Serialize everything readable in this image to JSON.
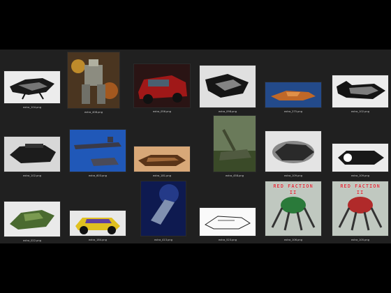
{
  "gallery": {
    "items": [
      {
        "filename": "extra_104.png",
        "style": "sketch"
      },
      {
        "filename": "extra_408.png",
        "style": "mech-painting"
      },
      {
        "filename": "extra_056.png",
        "style": "red-car"
      },
      {
        "filename": "extra_098.png",
        "style": "sketch"
      },
      {
        "filename": "extra_275.png",
        "style": "blue-ship"
      },
      {
        "filename": "extra_102.png",
        "style": "sketch"
      },
      {
        "filename": "extra_102.png",
        "style": "sketch"
      },
      {
        "filename": "extra_603.png",
        "style": "boats"
      },
      {
        "filename": "extra_181.png",
        "style": "hovercar"
      },
      {
        "filename": "extra_458.png",
        "style": "tank"
      },
      {
        "filename": "extra_109.png",
        "style": "sketch"
      },
      {
        "filename": "extra_109.png",
        "style": "sketch"
      },
      {
        "filename": "extra_022.png",
        "style": "green-ship"
      },
      {
        "filename": "extra_184.png",
        "style": "buggy"
      },
      {
        "filename": "extra_413.png",
        "style": "night-ship"
      },
      {
        "filename": "extra_523.png",
        "style": "line-sketch"
      },
      {
        "filename": "extra_106.png",
        "style": "walker-green",
        "banner": "RED FACTION II"
      },
      {
        "filename": "extra_105.png",
        "style": "walker-red",
        "banner": "RED FACTION II"
      }
    ]
  },
  "colors": {
    "background": "#000000",
    "viewport": "#202020",
    "label": "#cfcfcf"
  }
}
